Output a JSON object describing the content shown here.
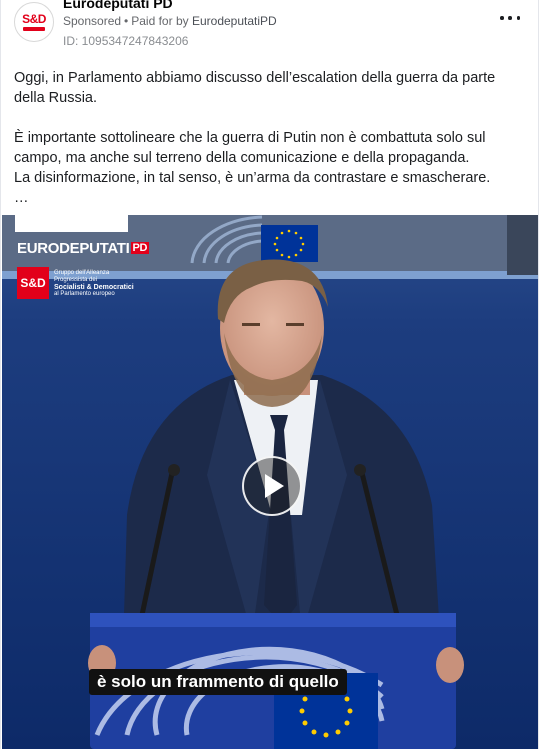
{
  "header": {
    "page_name": "Eurodeputati PD",
    "sponsored": "Sponsored",
    "paid_for_by_prefix": "Paid for by",
    "payer": "EurodeputatiPD",
    "ad_id": "ID: 1095347247843206",
    "avatar_logo": "S&D"
  },
  "post": {
    "paragraph1": "Oggi, in Parlamento abbiamo discusso dell’escalation della guerra da parte della Russia.",
    "paragraph2_line1": "È importante sottolineare che la guerra di Putin non è combattuta solo sul campo, ma anche sul terreno della comunicazione e della propaganda.",
    "paragraph2_line2": "La disinformazione, in tal senso, è un’arma da contrastare e smascherare.",
    "see_more": "…"
  },
  "video": {
    "brand": "EURODEPUTATI",
    "brand_pd": "PD",
    "sd_badge": "S&D",
    "sd_line1": "Gruppo dell'Alleanza Progressista dei",
    "sd_line2": "Socialisti & Democratici",
    "sd_line3": "al Parlamento europeo",
    "caption": "è solo un frammento di quello"
  },
  "colors": {
    "accent_red": "#e2001a",
    "eu_blue": "#003399",
    "eu_gold": "#ffcc00"
  }
}
